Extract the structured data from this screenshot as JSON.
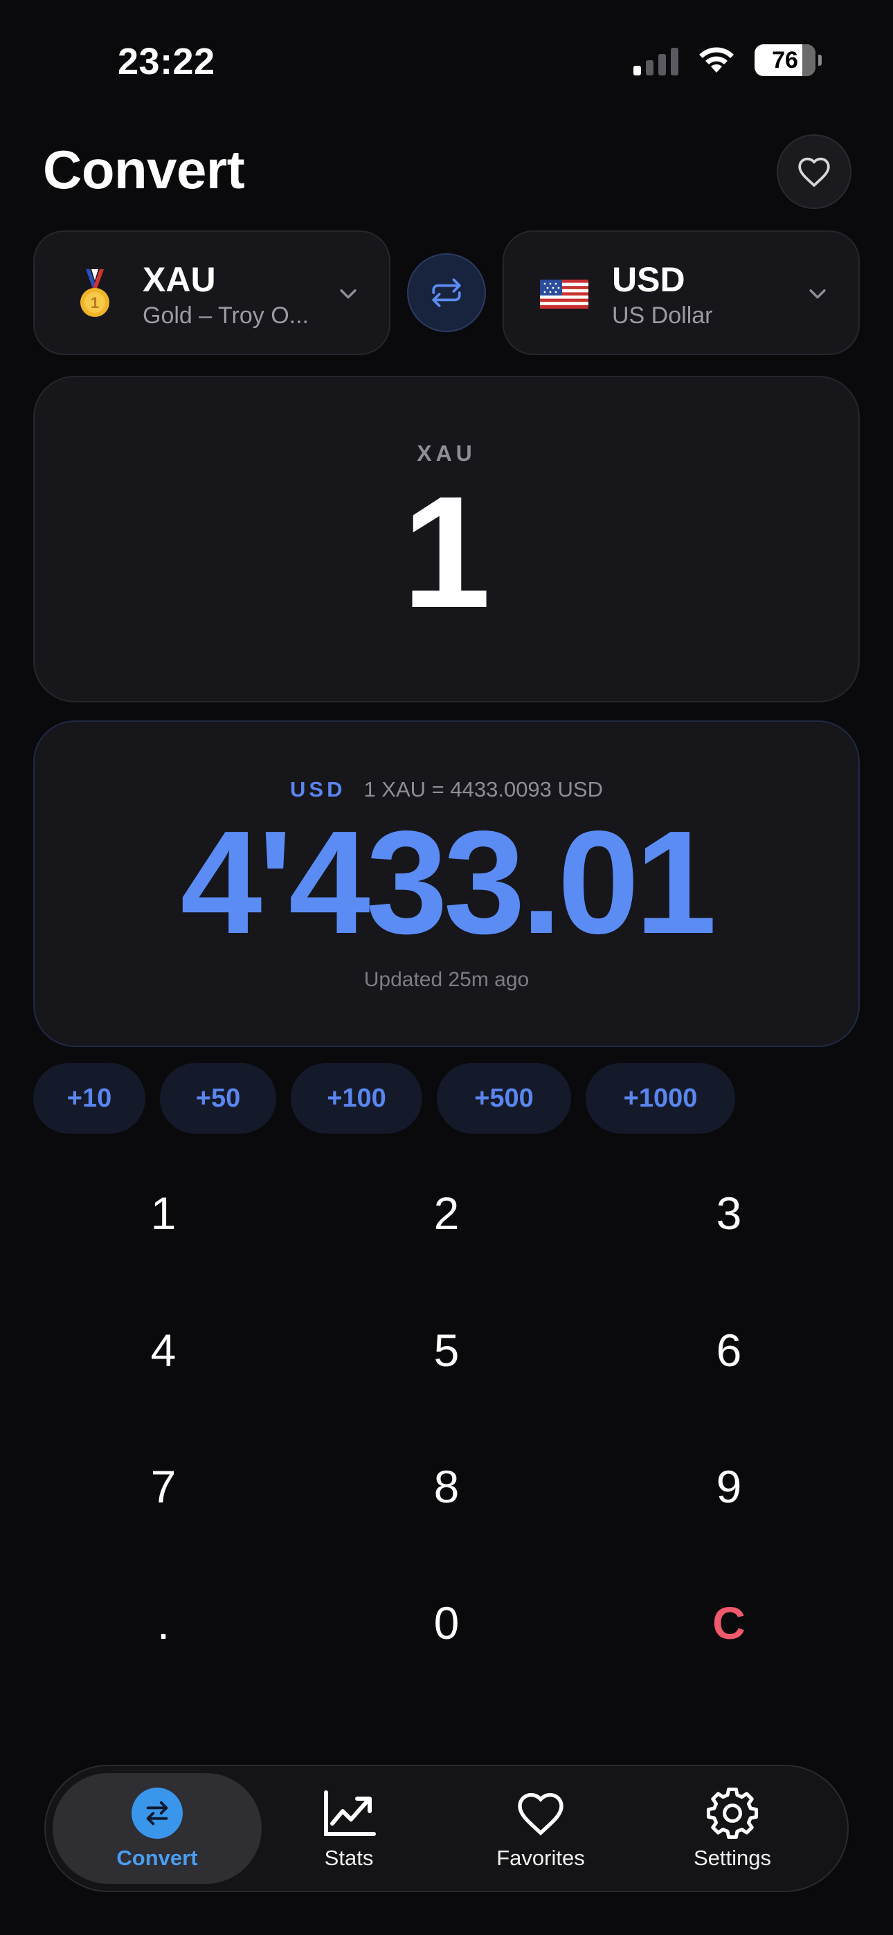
{
  "status_bar": {
    "time": "23:22",
    "battery": "76"
  },
  "header": {
    "title": "Convert"
  },
  "from_currency": {
    "code": "XAU",
    "name": "Gold – Troy O...",
    "flag": "gold-medal-icon"
  },
  "to_currency": {
    "code": "USD",
    "name": "US Dollar",
    "flag": "us-flag-icon"
  },
  "input": {
    "code": "XAU",
    "value": "1"
  },
  "result": {
    "code": "USD",
    "rate": "1 XAU = 4433.0093 USD",
    "value": "4'433.01",
    "updated": "Updated 25m ago"
  },
  "quick_add": [
    "+10",
    "+50",
    "+100",
    "+500",
    "+1000"
  ],
  "keypad": [
    "1",
    "2",
    "3",
    "4",
    "5",
    "6",
    "7",
    "8",
    "9",
    ".",
    "0",
    "C"
  ],
  "tabs": [
    {
      "label": "Convert",
      "icon": "swap-icon",
      "active": true
    },
    {
      "label": "Stats",
      "icon": "chart-icon",
      "active": false
    },
    {
      "label": "Favorites",
      "icon": "heart-icon",
      "active": false
    },
    {
      "label": "Settings",
      "icon": "gear-icon",
      "active": false
    }
  ],
  "colors": {
    "background": "#0a0a0d",
    "accent": "#5b8cf4",
    "clear": "#ef5a6c",
    "tab_active": "#3a96ea"
  }
}
